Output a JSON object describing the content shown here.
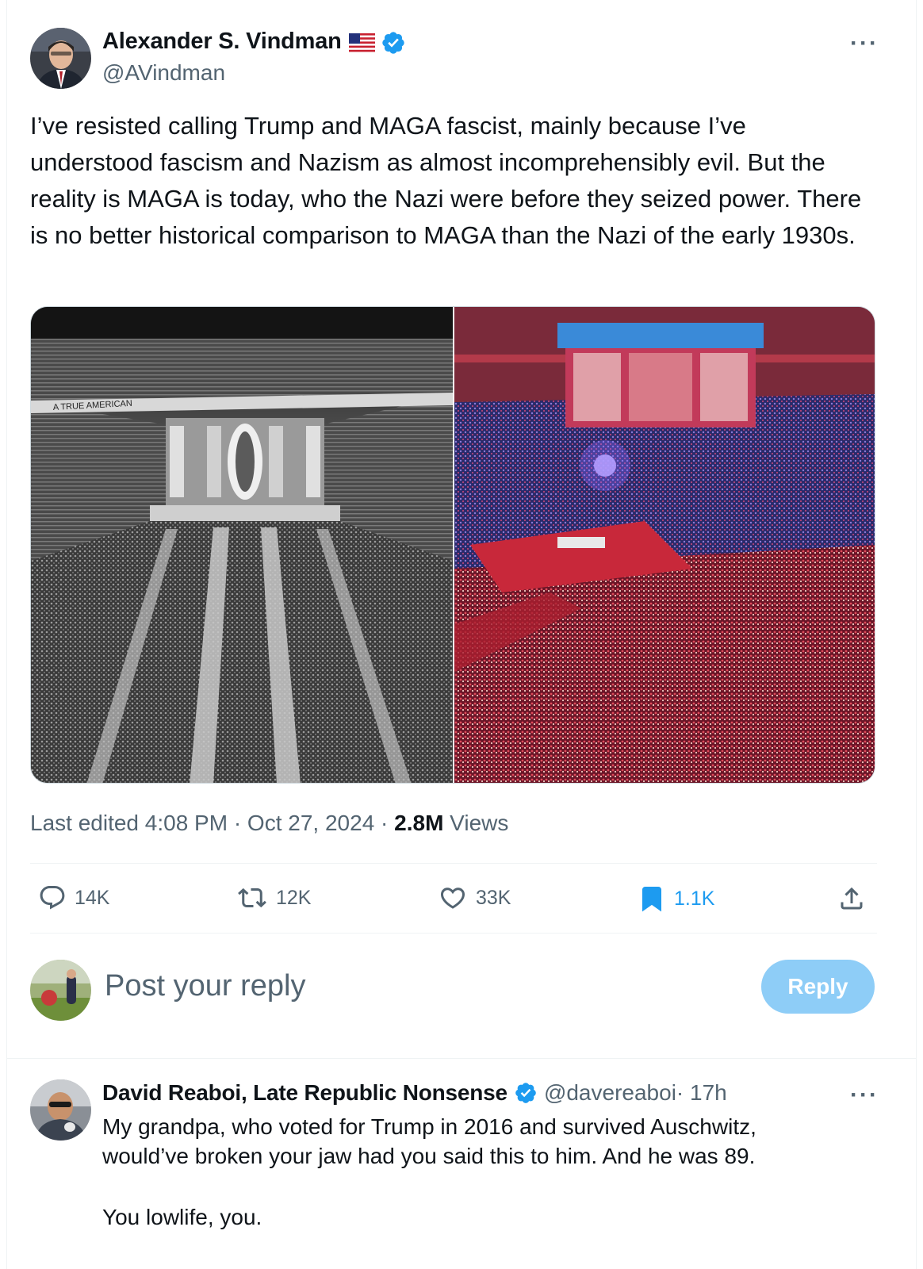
{
  "tweet": {
    "author_name": "Alexander S. Vindman",
    "author_handle": "@AVindman",
    "text": "I’ve resisted calling Trump and MAGA fascist, mainly because I’ve understood fascism and Nazism as almost incomprehensibly evil. But the reality is MAGA is today, who the Nazi were before they seized power. There is no better historical comparison to MAGA than the Nazi of the early 1930s.",
    "image_banner_text": "A TRUE AMERICAN",
    "edited_label": "Last edited 4:08 PM · Oct 27, 2024 · ",
    "views_count": "2.8M",
    "views_label": " Views",
    "icons": {
      "flag": "us-flag-icon",
      "verified": "verified-badge-icon",
      "more": "more-options-icon"
    }
  },
  "actions": {
    "replies": "14K",
    "reposts": "12K",
    "likes": "33K",
    "bookmarks": "1.1K"
  },
  "composer": {
    "placeholder": "Post your reply",
    "button_label": "Reply"
  },
  "reply": {
    "author_name": "David Reaboi, Late Republic Nonsense",
    "author_handle": "@davereaboi",
    "time": " · 17h",
    "line1": "My grandpa, who voted for Trump in 2016 and survived Auschwitz,",
    "line2": "would’ve broken your jaw had you said this to him. And he was 89.",
    "line3": "You lowlife, you."
  },
  "colors": {
    "accent": "#1d9bf0",
    "reply_button_disabled": "#8ecdf7",
    "secondary_text": "#536471",
    "divider": "#eff3f4"
  }
}
